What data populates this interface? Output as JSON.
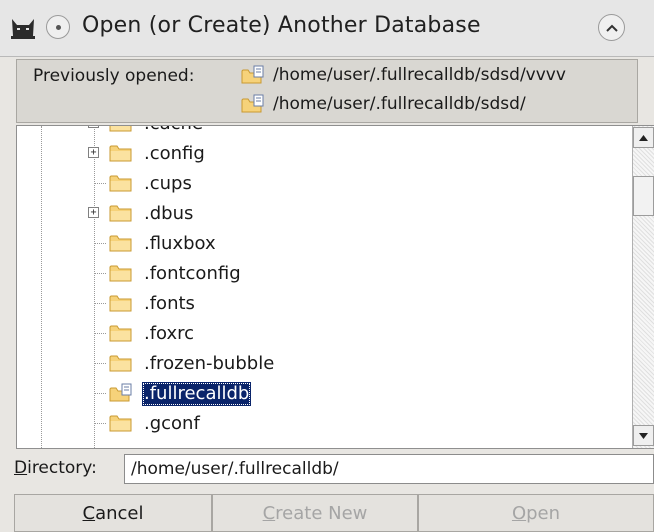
{
  "window": {
    "title": "Open (or Create) Another Database"
  },
  "previously_opened": {
    "label": "Previously opened:",
    "entries": [
      "/home/user/.fullrecalldb/sdsd/vvvv",
      "/home/user/.fullrecalldb/sdsd/"
    ]
  },
  "tree": {
    "items": [
      {
        "label": ".cache",
        "expander": "+"
      },
      {
        "label": ".config",
        "expander": "+"
      },
      {
        "label": ".cups",
        "expander": ""
      },
      {
        "label": ".dbus",
        "expander": "+"
      },
      {
        "label": ".fluxbox",
        "expander": ""
      },
      {
        "label": ".fontconfig",
        "expander": ""
      },
      {
        "label": ".fonts",
        "expander": ""
      },
      {
        "label": ".foxrc",
        "expander": ""
      },
      {
        "label": ".frozen-bubble",
        "expander": ""
      },
      {
        "label": ".fullrecalldb",
        "expander": "",
        "selected": true
      },
      {
        "label": ".gconf",
        "expander": ""
      }
    ]
  },
  "directory": {
    "label_mnemonic": "D",
    "label_rest": "irectory:",
    "value": "/home/user/.fullrecalldb/"
  },
  "buttons": {
    "cancel": {
      "mnemonic": "C",
      "rest": "ancel"
    },
    "create_new": {
      "mnemonic": "C",
      "rest": "reate New"
    },
    "open": {
      "mnemonic": "O",
      "rest": "pen"
    }
  },
  "colors": {
    "selection": "#0a246a",
    "folder": "#f2c96b",
    "disabled_text": "#a5a5a5"
  }
}
